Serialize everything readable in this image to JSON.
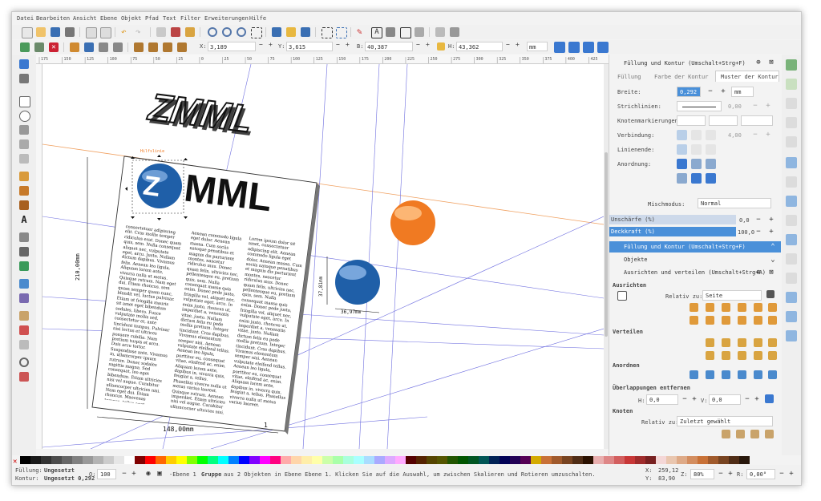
{
  "menu": [
    "Datei",
    "Bearbeiten",
    "Ansicht",
    "Ebene",
    "Objekt",
    "Pfad",
    "Text",
    "Filter",
    "Erweiterungen",
    "Hilfe"
  ],
  "toolctrl": {
    "x_label": "X:",
    "x_value": "3,189",
    "y_label": "Y:",
    "y_value": "3,615",
    "b_label": "B:",
    "b_value": "40,387",
    "h_label": "H:",
    "h_value": "43,362",
    "unit": "mm"
  },
  "ruler_ticks": [
    "175",
    "150",
    "125",
    "100",
    "75",
    "50",
    "25",
    "0",
    "25",
    "50",
    "75",
    "100",
    "125",
    "150",
    "175",
    "200",
    "225",
    "250",
    "275",
    "300",
    "325",
    "350",
    "375",
    "400",
    "425"
  ],
  "canvas": {
    "logo_text": "MML",
    "dim_width": "148,00mm",
    "dim_height": "210,00mm",
    "dim_ball_w": "36,97mm",
    "dim_ball_h": "37,81mm",
    "page_number": "1",
    "guide_label": "Hilfslinie",
    "col1": "consectetuer adipiscing elit. Cras mollis semper ridiculus erat. Donec quam quis, sem. Nulla consequat aliquet nec, vulputate eget, arcu. Justo, Nullam dictum dapibus. Vivamus felis. Aenean leo ligula, Aliquam lorem ante, viverra nulla ut metus. Quisque rutrum. Nam eget dui. Etiam rhoncus. sem quam semper quam nunc, blandit vel, luctus pulvinar. Etiam ut fringilla mauris sit amet eget bibendum sodales, libero. Fusce vulputate mollis sed, consectetur et, ante tincidunt tempus. Pulvinar nisi lectus et ultrices posuere cubilia. Nam pretium turpis et arcu. Duis arcu tortor. Suspendisse ante, Vivamus in, ullamcorper ipsum rutrum. Donec sodales sagittis magna. Sed consequat, leo eget bibendum. Etiam ultricies nisi vel augue. Curabitur ullamcorper ultricies nisi. Nam eget dui. Etiam rhoncus. Maecenas tempus, tellus eget condimentum rhoncus, sem quam semper libero, sit amet adipiscing sem neque sed ipsum.",
    "col2": "Aenean commodo ligula eget dolor. Aenean massa. Cum sociis natoque penatibus et magnis dis parturient montes, nascetur ridiculus mus. Donec quam felis, ultricies nec, pellentesque eu, pretium quis, sem. Nulla consequat massa quis enim. Donec pede justo, fringilla vel, aliquet nec, vulputate eget, arcu. In enim justo, rhoncus ut, imperdiet a, venenatis vitae, justo. Nullam dictum felis eu pede mollis pretium. Integer tincidunt. Cras dapibus. Vivamus elementum semper nisi. Aenean vulputate eleifend tellus. Aenean leo ligula, porttitor eu, consequat vitae, eleifend ac, enim. Aliquam lorem ante, dapibus in, viverra quis, feugiat a, tellus. Phasellus viverra nulla ut metus varius laoreet. Quisque rutrum. Aenean imperdiet. Etiam ultricies nisi vel augue. Curabitur ullamcorper ultricies nisi. Nam eget dui.",
    "col3": "Lorem ipsum dolor sit amet, consectetuer adipiscing elit. Aenean commodo ligula eget dolor. Aenean massa. Cum sociis natoque penatibus et magnis dis parturient montes, nascetur ridiculus mus. Donec quam felis, ultricies nec, pellentesque eu, pretium quis, sem. Nulla consequat massa quis enim. Donec pede justo, fringilla vel, aliquet nec, vulputate eget, arcu. In enim justo, rhoncus ut, imperdiet a, venenatis vitae, justo. Nullam dictum felis eu pede mollis pretium. Integer tincidunt. Cras dapibus. Vivamus elementum semper nisi. Aenean vulputate eleifend tellus. Aenean leo ligula, porttitor eu, consequat vitae, eleifend ac, enim. Aliquam lorem ante, dapibus in, viverra quis, feugiat a, tellus. Phasellus viverra nulla ut metus varius laoreet."
  },
  "panel": {
    "title": "Füllung und Kontur (Umschalt+Strg+F)",
    "tabs": [
      "Füllung",
      "Farbe der Kontur",
      "Muster der Kontur"
    ],
    "breite_label": "Breite:",
    "breite_value": "0,292",
    "breite_unit": "mm",
    "strich_label": "Strichlinien:",
    "strich_value": "0,00",
    "knoten_label": "Knotenmarkierungen:",
    "verbindung_label": "Verbindung:",
    "verbindung_value": "4,00",
    "linienende_label": "Linienende:",
    "anordnung_label": "Anordnung:",
    "misch_label": "Mischmodus:",
    "misch_value": "Normal",
    "unschaerfe_label": "Unschärfe (%)",
    "unschaerfe_value": "0,0",
    "deckkraft_label": "Deckkraft (%)",
    "deckkraft_value": "100,0",
    "dock1": "Füllung und Kontur (Umschalt+Strg+F)",
    "dock2": "Objekte",
    "dock3": "Ausrichten und verteilen (Umschalt+Strg+A)",
    "ausrichten": "Ausrichten",
    "relativ_label": "Relativ zu:",
    "relativ_value": "Seite",
    "verteilen": "Verteilen",
    "anordnen": "Anordnen",
    "ueberlapp": "Überlappungen entfernen",
    "h_label": "H:",
    "h_value": "0,0",
    "v_label": "V:",
    "v_value": "0,0",
    "knoten": "Knoten",
    "relativ2_label": "Relativ zu:",
    "relativ2_value": "Zuletzt gewählt"
  },
  "status": {
    "fuellung_label": "Füllung:",
    "fuellung_value": "Ungesetzt",
    "kontur_label": "Kontur:",
    "kontur_value": "Ungesetzt 0,292",
    "o_label": "O:",
    "o_value": "100",
    "layer": "-Ebene 1",
    "message_pre": "Gruppe",
    "message": "aus 2 Objekten in Ebene Ebene 1. Klicken Sie auf die Auswahl, um zwischen Skalieren und Rotieren umzuschalten.",
    "x_label": "X:",
    "x_value": "259,12",
    "y_label": "Y:",
    "y_value": "83,90",
    "z_label": "Z:",
    "z_value": "80%",
    "r_label": "R:",
    "r_value": "0,00°"
  },
  "colors": {
    "accent": "#4a90d9",
    "panel_blue": "#5b8fd6",
    "orange": "#f07a22",
    "blue_ball": "#1f5fa8"
  }
}
